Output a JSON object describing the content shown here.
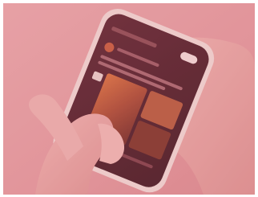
{
  "photo": {
    "subject": "hands-holding-smartphone",
    "tint_color": "#e07a82",
    "background_color": "#e7a2a6",
    "phone_frame_color": "#f3e1e0",
    "screen_color": "#4b1b25",
    "post_media_color": "#b8573b"
  }
}
